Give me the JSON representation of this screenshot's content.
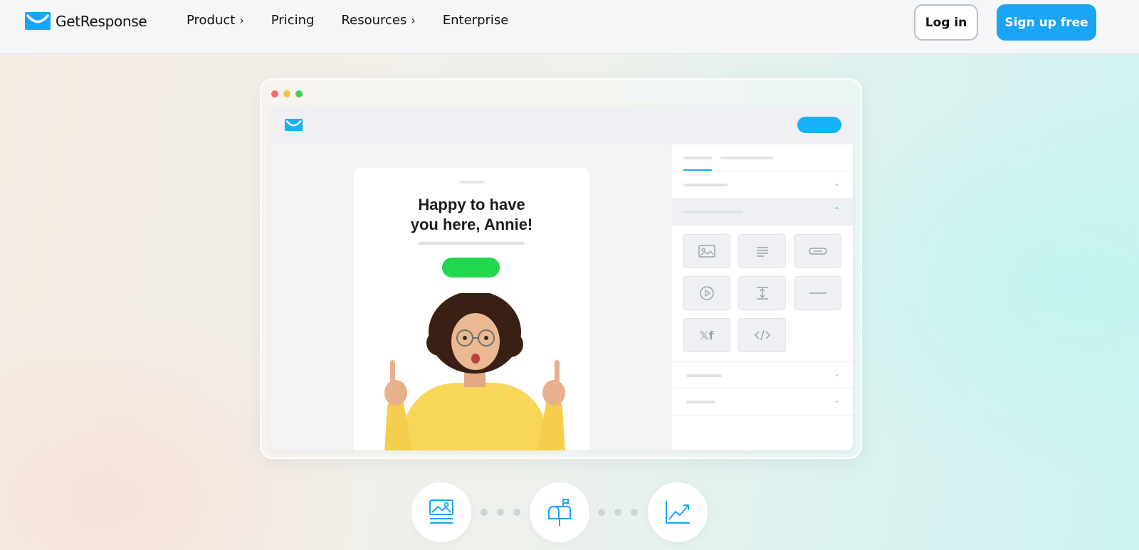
{
  "header": {
    "brand": "GetResponse",
    "nav": [
      {
        "label": "Product",
        "chevron": "›"
      },
      {
        "label": "Pricing",
        "chevron": ""
      },
      {
        "label": "Resources",
        "chevron": "›"
      },
      {
        "label": "Enterprise",
        "chevron": ""
      }
    ],
    "login_label": "Log in",
    "signup_label": "Sign up free"
  },
  "mockup": {
    "email_title_line1": "Happy to have",
    "email_title_line2": "you here, Annie!",
    "social_tile_text": "𝕏f"
  },
  "colors": {
    "brand_blue": "#1aa4f5",
    "cta_green": "#21d74c",
    "dot_red": "#f86a6a",
    "dot_yellow": "#f8c24a",
    "dot_green": "#3fd35a"
  },
  "icons": [
    "image-content-icon",
    "mailbox-icon",
    "growth-chart-icon"
  ]
}
